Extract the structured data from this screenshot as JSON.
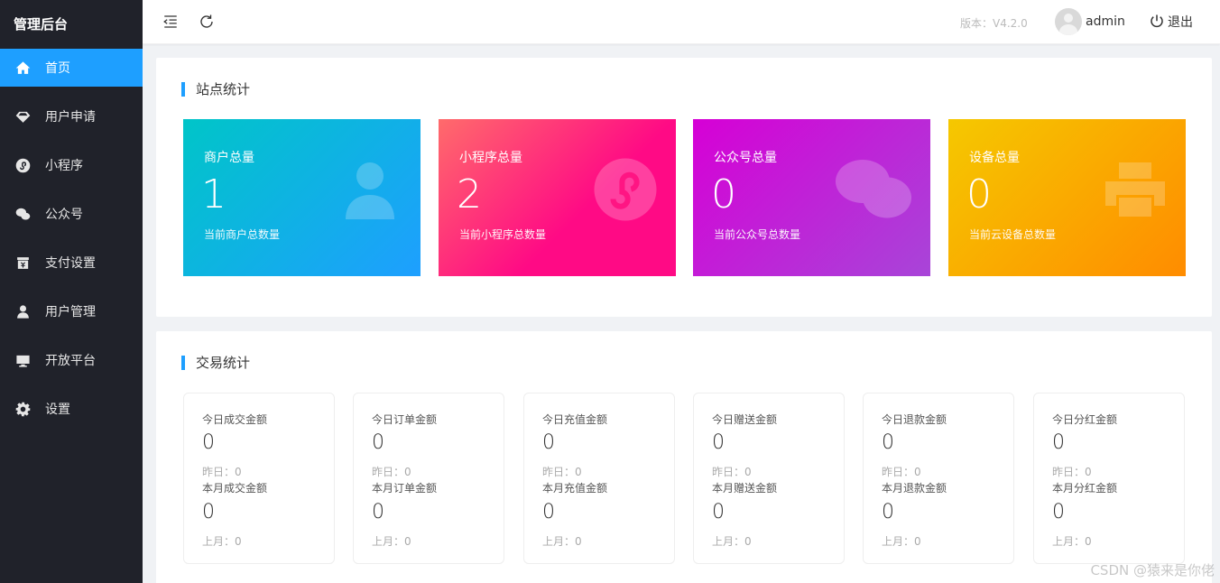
{
  "app": {
    "title": "管理后台"
  },
  "sidebar": {
    "items": [
      {
        "label": "首页",
        "icon": "home-icon",
        "active": true
      },
      {
        "label": "用户申请",
        "icon": "diamond-icon"
      },
      {
        "label": "小程序",
        "icon": "mini-program-icon"
      },
      {
        "label": "公众号",
        "icon": "wechat-icon"
      },
      {
        "label": "支付设置",
        "icon": "payment-icon"
      },
      {
        "label": "用户管理",
        "icon": "user-icon"
      },
      {
        "label": "开放平台",
        "icon": "monitor-icon"
      },
      {
        "label": "设置",
        "icon": "gear-icon"
      }
    ]
  },
  "header": {
    "version": "版本：V4.2.0",
    "username": "admin",
    "logout_label": "退出"
  },
  "site_stats": {
    "title": "站点统计",
    "cards": [
      {
        "title": "商户总量",
        "value": "1",
        "desc": "当前商户总数量",
        "icon": "user-silhouette-icon",
        "gradient": [
          "#1e9fff",
          "#00c5c8"
        ]
      },
      {
        "title": "小程序总量",
        "value": "2",
        "desc": "当前小程序总数量",
        "icon": "mini-program-icon",
        "gradient": [
          "#ff0a85",
          "#ff6b6b"
        ]
      },
      {
        "title": "公众号总量",
        "value": "0",
        "desc": "当前公众号总数量",
        "icon": "wechat-icon",
        "gradient": [
          "#a845d8",
          "#d600d6"
        ]
      },
      {
        "title": "设备总量",
        "value": "0",
        "desc": "当前云设备总数量",
        "icon": "printer-icon",
        "gradient": [
          "#ff8c00",
          "#f5c800"
        ]
      }
    ]
  },
  "trade_stats": {
    "title": "交易统计",
    "cards": [
      {
        "today_label": "今日成交金额",
        "today_value": "0",
        "yesterday": "昨日：0",
        "month_label": "本月成交金额",
        "month_value": "0",
        "last_month": "上月：0"
      },
      {
        "today_label": "今日订单金额",
        "today_value": "0",
        "yesterday": "昨日：0",
        "month_label": "本月订单金额",
        "month_value": "0",
        "last_month": "上月：0"
      },
      {
        "today_label": "今日充值金额",
        "today_value": "0",
        "yesterday": "昨日：0",
        "month_label": "本月充值金额",
        "month_value": "0",
        "last_month": "上月：0"
      },
      {
        "today_label": "今日赠送金额",
        "today_value": "0",
        "yesterday": "昨日：0",
        "month_label": "本月赠送金额",
        "month_value": "0",
        "last_month": "上月：0"
      },
      {
        "today_label": "今日退款金额",
        "today_value": "0",
        "yesterday": "昨日：0",
        "month_label": "本月退款金额",
        "month_value": "0",
        "last_month": "上月：0"
      },
      {
        "today_label": "今日分红金额",
        "today_value": "0",
        "yesterday": "昨日：0",
        "month_label": "本月分红金额",
        "month_value": "0",
        "last_month": "上月：0"
      }
    ]
  },
  "watermark": "CSDN @猿来是你佬"
}
